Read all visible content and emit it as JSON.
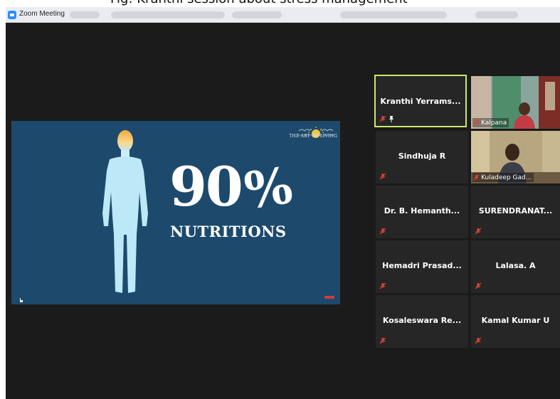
{
  "caption": "Fig: Kranthi session about stress management",
  "window": {
    "title": "Zoom Meeting"
  },
  "slide": {
    "logo_text": "THE ART OF LIVING",
    "big_number": "90",
    "big_percent": "%",
    "subtitle": "NUTRITIONS"
  },
  "participants": {
    "active": {
      "name": "Kranthi Yerrams...",
      "muted": true,
      "pinned": true
    },
    "kalpana": {
      "name": "Kalpana",
      "muted": true
    },
    "sindhuja": {
      "name": "Sindhuja R",
      "muted": true
    },
    "kuladeep": {
      "name": "Kuladeep Gad...",
      "muted": true
    },
    "hemanth": {
      "name": "Dr. B. Hemanth...",
      "muted": true
    },
    "surendranat": {
      "name": "SURENDRANAT...",
      "muted": true
    },
    "hemadri": {
      "name": "Hemadri Prasad...",
      "muted": true
    },
    "lalasa": {
      "name": "Lalasa. A",
      "muted": true
    },
    "kosaleswara": {
      "name": "Kosaleswara Re...",
      "muted": true
    },
    "kamal": {
      "name": "Kamal Kumar U",
      "muted": true
    }
  },
  "icons": {
    "mute": "microphone-muted-icon",
    "pin": "pin-icon",
    "app": "zoom-app-icon"
  },
  "colors": {
    "active_border": "#c9e86b",
    "slide_bg": "#1d4a6c",
    "mute_red": "#e0463c",
    "tile_bg": "#262626"
  }
}
